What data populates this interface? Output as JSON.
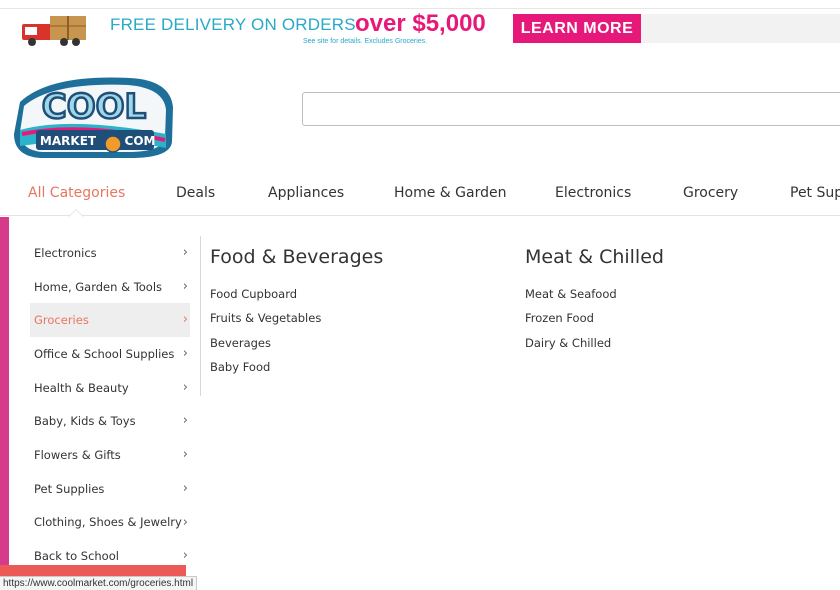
{
  "promo": {
    "text": "FREE DELIVERY ON ORDERS",
    "highlight": "over $5,000",
    "fine_print": "See site for details. Excludes Groceries.",
    "button_label": "LEARN MORE",
    "accent_color": "#e6197b",
    "text_color": "#2aa9c7"
  },
  "logo": {
    "word": "COOL",
    "sub_left": "MARKET",
    "sub_right": "COM"
  },
  "search": {
    "value": "",
    "placeholder": ""
  },
  "nav": {
    "items": [
      {
        "label": "All Categories",
        "active": true
      },
      {
        "label": "Deals"
      },
      {
        "label": "Appliances"
      },
      {
        "label": "Home & Garden"
      },
      {
        "label": "Electronics"
      },
      {
        "label": "Grocery"
      },
      {
        "label": "Pet Sup"
      }
    ]
  },
  "sidebar": {
    "items": [
      {
        "label": "Electronics",
        "icon": "chevron-right-icon"
      },
      {
        "label": "Home, Garden & Tools",
        "icon": "chevron-right-icon"
      },
      {
        "label": "Groceries",
        "icon": "chevron-right-icon",
        "active": true
      },
      {
        "label": "Office & School Supplies",
        "icon": "chevron-right-icon"
      },
      {
        "label": "Health & Beauty",
        "icon": "chevron-right-icon"
      },
      {
        "label": "Baby, Kids & Toys",
        "icon": "chevron-right-icon"
      },
      {
        "label": "Flowers & Gifts",
        "icon": "chevron-right-icon"
      },
      {
        "label": "Pet Supplies",
        "icon": "chevron-right-icon"
      },
      {
        "label": "Clothing, Shoes & Jewelry",
        "icon": "chevron-right-icon"
      },
      {
        "label": "Back to School",
        "icon": "chevron-right-icon"
      }
    ],
    "chevron": "›"
  },
  "submenu": {
    "columns": [
      {
        "title": "Food & Beverages",
        "links": [
          "Food Cupboard",
          "Fruits & Vegetables",
          "Beverages",
          "Baby Food"
        ]
      },
      {
        "title": "Meat & Chilled",
        "links": [
          "Meat & Seafood",
          "Frozen Food",
          "Dairy & Chilled"
        ]
      }
    ]
  },
  "status_bar": {
    "url": "https://www.coolmarket.com/groceries.html"
  },
  "colors": {
    "active_text": "#e8765f",
    "side_accent": "#d63b8b"
  }
}
